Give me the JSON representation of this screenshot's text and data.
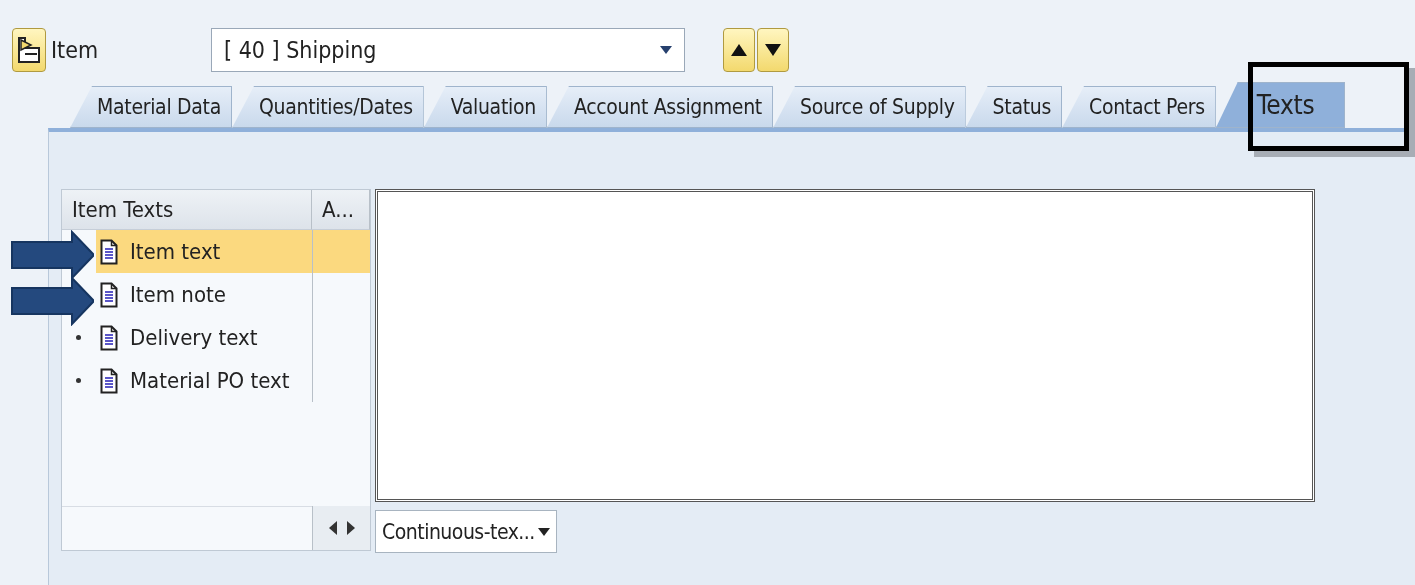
{
  "header": {
    "label": "Item",
    "dropdown_value": "[ 40 ] Shipping"
  },
  "tabs": [
    {
      "label": "Material Data",
      "selected": false
    },
    {
      "label": "Quantities/Dates",
      "selected": false
    },
    {
      "label": "Valuation",
      "selected": false
    },
    {
      "label": "Account Assignment",
      "selected": false
    },
    {
      "label": "Source of Supply",
      "selected": false
    },
    {
      "label": "Status",
      "selected": false
    },
    {
      "label": "Contact Pers",
      "selected": false
    },
    {
      "label": "Texts",
      "selected": true
    }
  ],
  "text_tree": {
    "columns": [
      "Item Texts",
      "A..."
    ],
    "rows": [
      {
        "label": "Item text",
        "selected": true
      },
      {
        "label": "Item note",
        "selected": false
      },
      {
        "label": "Delivery text",
        "selected": false
      },
      {
        "label": "Material PO text",
        "selected": false
      }
    ]
  },
  "format_dropdown": {
    "value": "Continuous-tex..."
  }
}
